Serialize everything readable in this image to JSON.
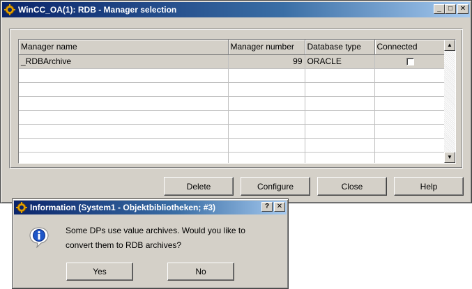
{
  "main_window": {
    "title": "WinCC_OA(1): RDB - Manager selection",
    "title_buttons": {
      "minimize": "_",
      "maximize": "□",
      "close": "✕"
    }
  },
  "table": {
    "columns": [
      "Manager name",
      "Manager number",
      "Database type",
      "Connected"
    ],
    "rows": [
      {
        "name": "_RDBArchive",
        "number": "99",
        "db_type": "ORACLE",
        "connected": false
      }
    ],
    "scroll_up": "▲",
    "scroll_down": "▼"
  },
  "buttons": {
    "delete": "Delete",
    "configure": "Configure",
    "close": "Close",
    "help": "Help"
  },
  "dialog": {
    "title": "Information (System1 - Objektbibliotheken; #3)",
    "help_btn": "?",
    "close_btn": "✕",
    "message_line1": "Some DPs use value archives. Would you like to",
    "message_line2": "convert them to RDB archives?",
    "yes": "Yes",
    "no": "No"
  },
  "icons": {
    "app": "gear-icon",
    "message": "information-icon"
  },
  "colors": {
    "titlebar_start": "#0a246a",
    "titlebar_end": "#a6caf0",
    "window_bg": "#d4d0c8"
  }
}
